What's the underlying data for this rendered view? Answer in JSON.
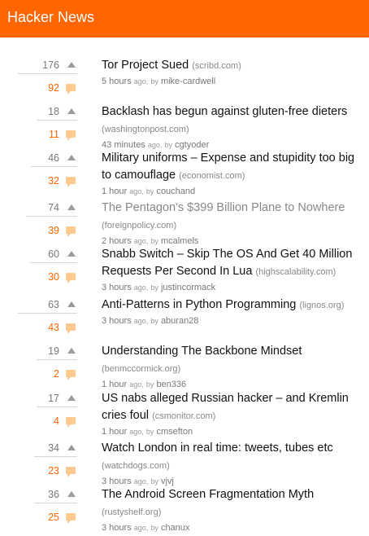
{
  "app": {
    "title": "Hacker News"
  },
  "labels": {
    "ago": "ago,",
    "by": "by"
  },
  "items": [
    {
      "votes": "176",
      "comments": "92",
      "title": "Tor Project Sued",
      "domain": "(scribd.com)",
      "time": "5 hours",
      "user": "mike-cardwell"
    },
    {
      "votes": "18",
      "comments": "11",
      "title": "Backlash has begun against gluten-free dieters",
      "domain": "(washingtonpost.com)",
      "time": "43 minutes",
      "user": "cgtyoder"
    },
    {
      "votes": "46",
      "comments": "32",
      "title": "Military uniforms – Expense and stupidity too big to camouflage",
      "domain": "(economist.com)",
      "time": "1 hour",
      "user": "couchand"
    },
    {
      "votes": "74",
      "comments": "39",
      "title": "The Pentagon's $399 Billion Plane to Nowhere",
      "domain": "(foreignpolicy.com)",
      "time": "2 hours",
      "user": "mcalmels",
      "visited": true
    },
    {
      "votes": "60",
      "comments": "30",
      "title": "Snabb Switch – Skip The OS And Get 40 Million Requests Per Second In Lua",
      "domain": "(highscalability.com)",
      "time": "3 hours",
      "user": "justincormack"
    },
    {
      "votes": "63",
      "comments": "43",
      "title": "Anti-Patterns in Python Programming",
      "domain": "(lignos.org)",
      "time": "3 hours",
      "user": "aburan28"
    },
    {
      "votes": "19",
      "comments": "2",
      "title": "Understanding The Backbone Mindset",
      "domain": "(benmccormick.org)",
      "time": "1 hour",
      "user": "ben336"
    },
    {
      "votes": "17",
      "comments": "4",
      "title": "US nabs alleged Russian hacker – and Kremlin cries foul",
      "domain": "(csmonitor.com)",
      "time": "1 hour",
      "user": "cmsefton"
    },
    {
      "votes": "34",
      "comments": "23",
      "title": "Watch London in real time: tweets, tubes etc",
      "domain": "(watchdogs.com)",
      "time": "3 hours",
      "user": "vjvj"
    },
    {
      "votes": "36",
      "comments": "25",
      "title": "The Android Screen Fragmentation Myth",
      "domain": "(rustyshelf.org)",
      "time": "3 hours",
      "user": "chanux"
    }
  ]
}
